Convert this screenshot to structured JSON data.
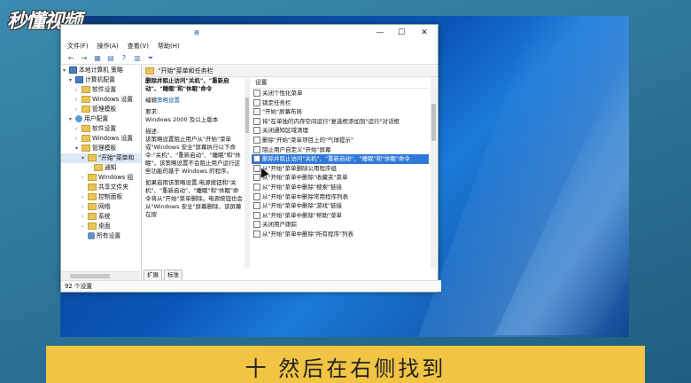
{
  "watermark": "秒懂视频",
  "window": {
    "title": "器",
    "min": "—",
    "max": "☐",
    "close": "✕",
    "menu": [
      "文件(F)",
      "操作(A)",
      "查看(V)",
      "帮助(H)"
    ],
    "toolbar_icons": [
      "←",
      "→",
      "▦",
      "▤",
      "?",
      "▥",
      "⏷"
    ],
    "tree": [
      {
        "arrow": "▾",
        "icon": "computer",
        "label": "本地计算机 策略",
        "indent": 0
      },
      {
        "arrow": "▾",
        "icon": "computer-sm",
        "label": "计算机配置",
        "indent": 1
      },
      {
        "arrow": "›",
        "icon": "folder",
        "label": "软件设置",
        "indent": 2
      },
      {
        "arrow": "›",
        "icon": "folder",
        "label": "Windows 设置",
        "indent": 2
      },
      {
        "arrow": "›",
        "icon": "folder",
        "label": "管理模板",
        "indent": 2
      },
      {
        "arrow": "▾",
        "icon": "user",
        "label": "用户配置",
        "indent": 1
      },
      {
        "arrow": "›",
        "icon": "folder",
        "label": "软件设置",
        "indent": 2
      },
      {
        "arrow": "›",
        "icon": "folder",
        "label": "Windows 设置",
        "indent": 2
      },
      {
        "arrow": "▾",
        "icon": "folder",
        "label": "管理模板",
        "indent": 2
      },
      {
        "arrow": "▾",
        "icon": "folder",
        "label": "\"开始\"菜单和",
        "indent": 3
      },
      {
        "arrow": "",
        "icon": "folder",
        "label": "通知",
        "indent": 4
      },
      {
        "arrow": "›",
        "icon": "folder",
        "label": "Windows 组",
        "indent": 3
      },
      {
        "arrow": "",
        "icon": "folder",
        "label": "共享文件夹",
        "indent": 3
      },
      {
        "arrow": "›",
        "icon": "folder",
        "label": "控制面板",
        "indent": 3
      },
      {
        "arrow": "›",
        "icon": "folder",
        "label": "网络",
        "indent": 3
      },
      {
        "arrow": "›",
        "icon": "folder",
        "label": "系统",
        "indent": 3
      },
      {
        "arrow": "›",
        "icon": "folder",
        "label": "桌面",
        "indent": 3
      },
      {
        "arrow": "",
        "icon": "settings",
        "label": "所有设置",
        "indent": 3
      }
    ],
    "right_header": "\"开始\"菜单和任务栏",
    "description": {
      "title": "删除并阻止访问\"关机\"、\"重新启动\"、\"睡眠\"和\"休眠\"命令",
      "edit_prefix": "编辑",
      "edit_link": "策略设置",
      "req_label": "要求:",
      "req_value": "Windows 2000 及以上版本",
      "desc_label": "描述:",
      "desc_text": "该策略设置阻止用户从\"开始\"菜单或\"Windows 安全\"屏幕执行以下命令:\"关机\"、\"重新启动\"、\"睡眠\"和\"休眠\"。该策略设置不会阻止用户运行这些功能的基于 Windows 的程序。",
      "desc_text2": "如果启用该策略设置,电源按钮和\"关机\"、\"重新启动\"、\"睡眠\"和\"休眠\"命令将从\"开始\"菜单删除。电源按钮也会从\"Windows 安全\"屏幕删除，该屏幕在按"
    },
    "list_header": "设置",
    "list_items": [
      "关闭个性化菜单",
      "锁定任务栏",
      "\"开始\"屏幕布局",
      "将\"在单独的内存空间运行\"复选框添加到\"运行\"对话框",
      "关闭通知区域清理",
      "删除\"开始\"菜单项目上的\"气球提示\"",
      "阻止用户自定义\"开始\"屏幕",
      "删除并阻止访问\"关机\"、\"重新启动\"、\"睡眠\"和\"休眠\"命令",
      "从\"开始\"菜单删除公用程序组",
      "从\"开始\"菜单中删除\"收藏夹\"菜单",
      "从\"开始\"菜单中删除\"搜索\"链接",
      "从\"开始\"菜单中删除常用程序列表",
      "从\"开始\"菜单中删除\"游戏\"链接",
      "从\"开始\"菜单中删除\"帮助\"菜单",
      "关闭用户跟踪",
      "从\"开始\"菜单中删除\"所有程序\"列表"
    ],
    "selected_index": 7,
    "tabs": [
      "扩展",
      "标准"
    ],
    "status": "92 个设置"
  },
  "caption": "十 然后在右侧找到"
}
